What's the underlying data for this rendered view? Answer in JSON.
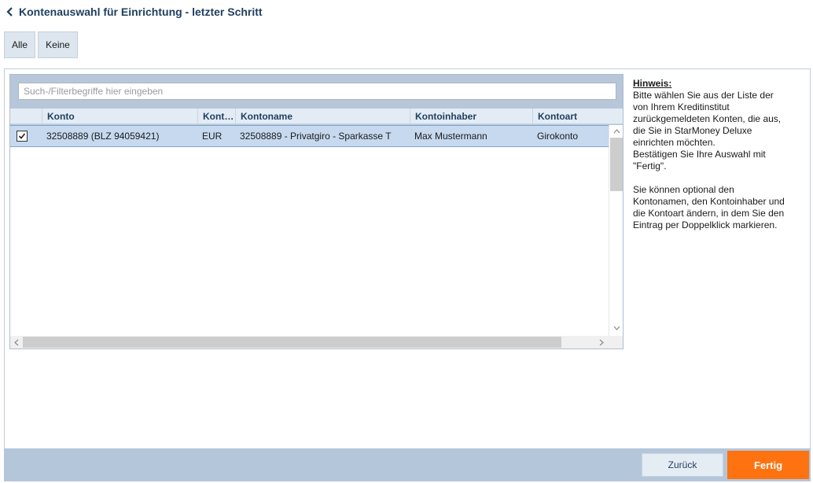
{
  "header": {
    "title": "Kontenauswahl für Einrichtung - letzter Schritt"
  },
  "selection": {
    "all_label": "Alle",
    "none_label": "Keine"
  },
  "search": {
    "placeholder": "Such-/Filterbegriffe hier eingeben",
    "value": ""
  },
  "table": {
    "columns": [
      {
        "key": "konto",
        "label": "Konto"
      },
      {
        "key": "waehrung",
        "label": "Kontowährung"
      },
      {
        "key": "kontoname",
        "label": "Kontoname"
      },
      {
        "key": "kontoinhaber",
        "label": "Kontoinhaber"
      },
      {
        "key": "kontoart",
        "label": "Kontoart"
      }
    ],
    "rows": [
      {
        "checked": true,
        "konto": "32508889 (BLZ 94059421)",
        "waehrung": "EUR",
        "kontoname": "32508889 - Privatgiro - Sparkasse T",
        "kontoinhaber": "Max Mustermann",
        "kontoart": "Girokonto"
      }
    ]
  },
  "hint": {
    "title": "Hinweis:",
    "p1": "Bitte wählen Sie aus der Liste der\nvon Ihrem Kreditinstitut\nzurückgemeldeten Konten, die aus,\ndie Sie in StarMoney Deluxe\neinrichten möchten.\nBestätigen Sie Ihre Auswahl mit\n\"Fertig\".",
    "p2": "Sie können optional den\nKontonamen, den Kontoinhaber und\ndie Kontoart ändern, in dem Sie den\nEintrag per Doppelklick markieren."
  },
  "footer": {
    "back_label": "Zurück",
    "finish_label": "Fertig"
  },
  "colors": {
    "accent": "#ff7210",
    "title": "#1f3e5e",
    "selected_row": "#c6d9ee"
  },
  "icons": {
    "back": "chevron-left-icon",
    "checkbox": "checkmark-icon"
  }
}
